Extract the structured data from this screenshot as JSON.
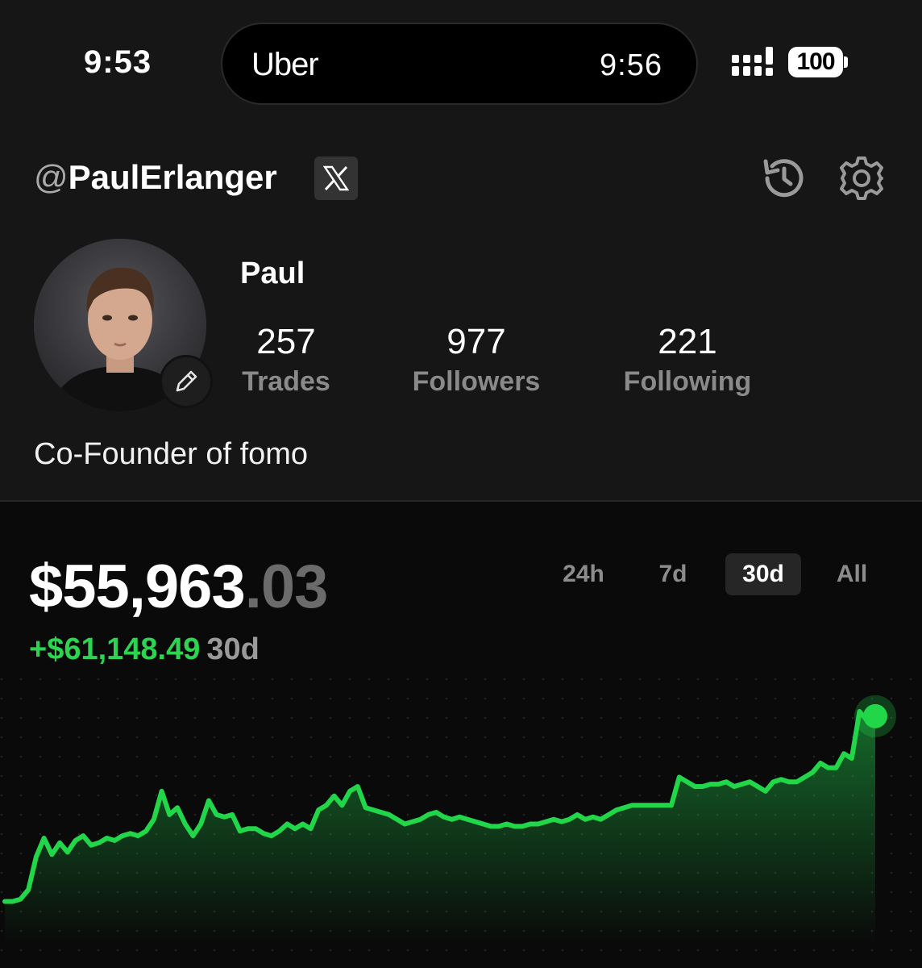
{
  "status_bar": {
    "time": "9:53",
    "island_app": "Uber",
    "island_time": "9:56",
    "battery": "100"
  },
  "header": {
    "handle_at": "@",
    "handle_name": "PaulErlanger",
    "icons": [
      "x-logo-icon",
      "history-icon",
      "gear-icon"
    ]
  },
  "profile": {
    "name": "Paul",
    "stats": [
      {
        "value": "257",
        "label": "Trades"
      },
      {
        "value": "977",
        "label": "Followers"
      },
      {
        "value": "221",
        "label": "Following"
      }
    ],
    "bio": "Co-Founder of fomo"
  },
  "portfolio": {
    "balance_main": "$55,963",
    "balance_cents": ".03",
    "change_amount": "+$61,148.49",
    "change_period": "30d",
    "ranges": [
      "24h",
      "7d",
      "30d",
      "All"
    ],
    "active_range": "30d"
  },
  "colors": {
    "accent_green": "#2dd44f",
    "background_top": "#161616",
    "background_bottom": "#0a0a0a"
  },
  "chart_data": {
    "type": "area",
    "y_label": "",
    "x_label": "",
    "grid": "dotted",
    "values": [
      5,
      5,
      6,
      10,
      24,
      32,
      25,
      30,
      26,
      31,
      33,
      29,
      30,
      32,
      31,
      33,
      34,
      33,
      35,
      40,
      52,
      42,
      45,
      38,
      33,
      38,
      48,
      42,
      41,
      42,
      35,
      36,
      36,
      34,
      33,
      35,
      38,
      36,
      38,
      36,
      44,
      46,
      50,
      46,
      52,
      54,
      45,
      44,
      43,
      42,
      40,
      38,
      39,
      40,
      42,
      43,
      41,
      40,
      41,
      40,
      39,
      38,
      37,
      37,
      38,
      37,
      37,
      38,
      38,
      39,
      40,
      39,
      40,
      42,
      40,
      41,
      40,
      42,
      44,
      45,
      46,
      46,
      46,
      46,
      46,
      46,
      58,
      56,
      54,
      54,
      55,
      55,
      56,
      54,
      55,
      56,
      54,
      52,
      56,
      57,
      56,
      56,
      58,
      60,
      64,
      62,
      62,
      68,
      66,
      86,
      82,
      84
    ]
  }
}
